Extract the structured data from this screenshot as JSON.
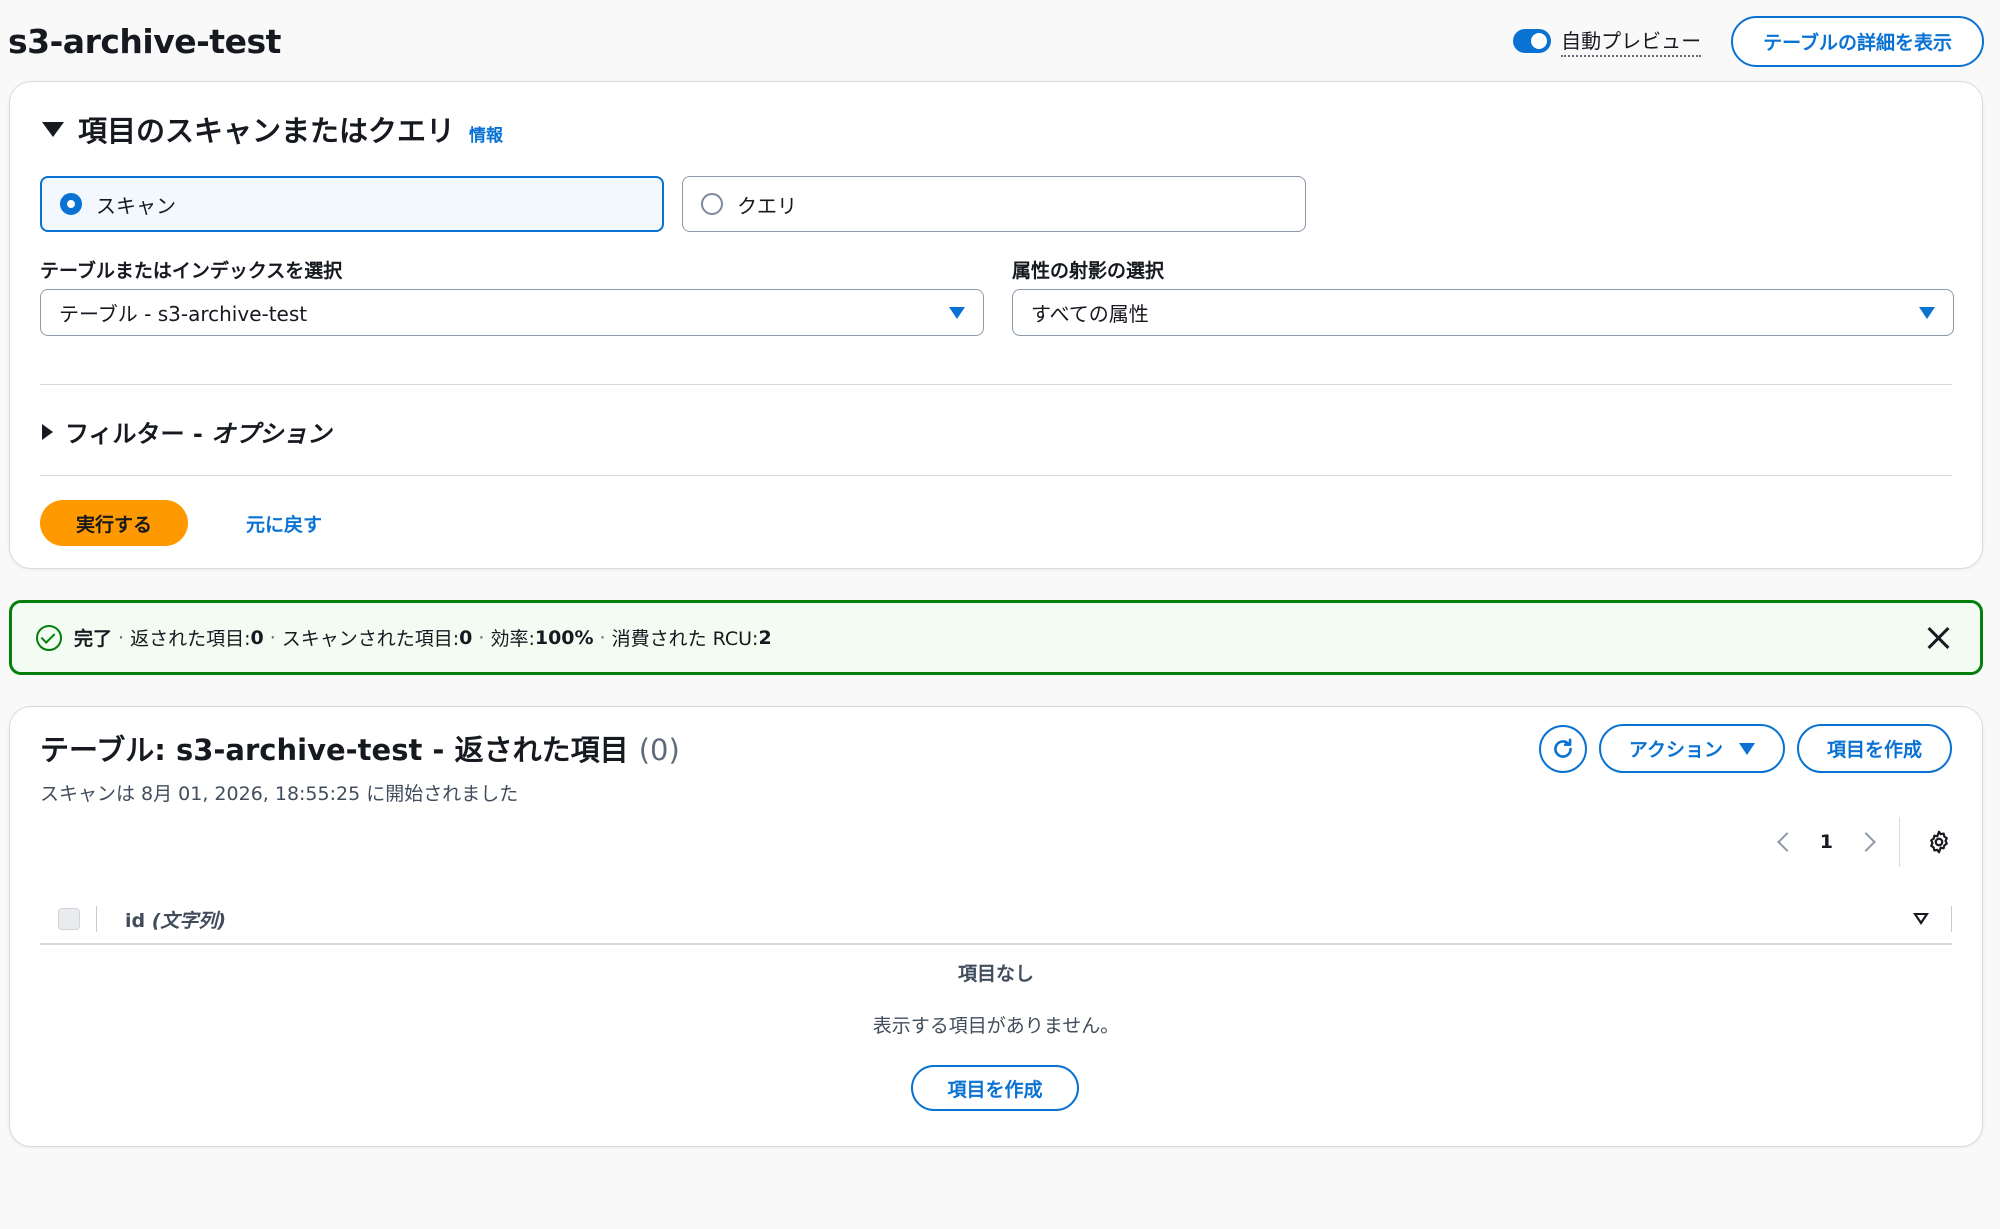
{
  "header": {
    "title": "s3-archive-test",
    "auto_preview_label": "自動プレビュー",
    "table_details_button": "テーブルの詳細を表示"
  },
  "scan_query": {
    "title": "項目のスキャンまたはクエリ",
    "info_link": "情報",
    "options": [
      {
        "label": "スキャン",
        "selected": true
      },
      {
        "label": "クエリ",
        "selected": false
      }
    ],
    "table_select": {
      "label": "テーブルまたはインデックスを選択",
      "value": "テーブル - s3-archive-test"
    },
    "projection_select": {
      "label": "属性の射影の選択",
      "value": "すべての属性"
    },
    "filter_label": "フィルター - ",
    "filter_optional": "オプション",
    "run_button": "実行する",
    "reset_link": "元に戻す"
  },
  "alert": {
    "status": "完了",
    "returned_label": "返された項目: ",
    "returned_value": "0",
    "scanned_label": "スキャンされた項目: ",
    "scanned_value": "0",
    "efficiency_label": "効率: ",
    "efficiency_value": "100%",
    "rcu_label": "消費された RCU: ",
    "rcu_value": "2",
    "separator": "·"
  },
  "results": {
    "title": "テーブル: s3-archive-test - 返された項目",
    "count": "(0)",
    "subtitle": "スキャンは 8月 01, 2026, 18:55:25 に開始されました",
    "actions_button": "アクション",
    "create_item_button": "項目を作成",
    "page_number": "1",
    "column_name": "id",
    "column_type": "(文字列)",
    "empty_title": "項目なし",
    "empty_text": "表示する項目がありません。",
    "empty_create_button": "項目を作成"
  },
  "colors": {
    "primary_blue": "#0972d3",
    "orange": "#ff9900",
    "success_green": "#037f0c"
  }
}
